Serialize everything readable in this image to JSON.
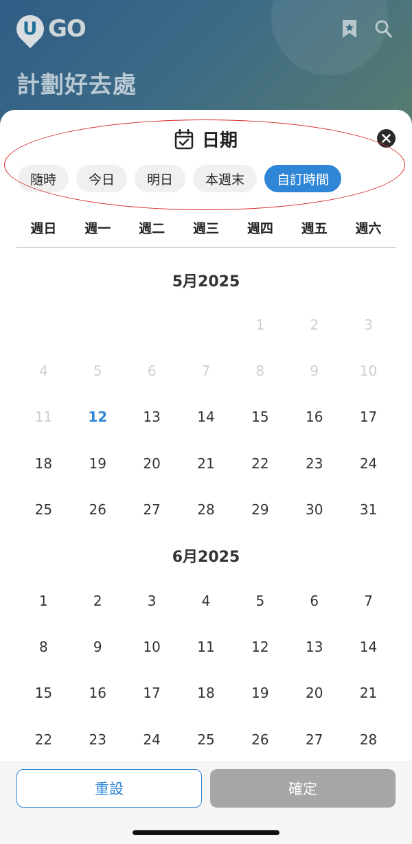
{
  "app": {
    "logo_letter": "U",
    "logo_text": "GO",
    "background_title": "計劃好去處",
    "icons": {
      "bookmark": "bookmark-star-icon",
      "search": "search-icon"
    }
  },
  "sheet": {
    "title": "日期",
    "title_icon": "calendar-check-icon",
    "close_icon": "close-icon",
    "chips": [
      {
        "label": "隨時",
        "active": false
      },
      {
        "label": "今日",
        "active": false
      },
      {
        "label": "明日",
        "active": false
      },
      {
        "label": "本週末",
        "active": false
      },
      {
        "label": "自訂時間",
        "active": true
      }
    ],
    "weekdays": [
      "週日",
      "週一",
      "週二",
      "週三",
      "週四",
      "週五",
      "週六"
    ]
  },
  "months": [
    {
      "title": "5月2025",
      "days": [
        "",
        "",
        "",
        "",
        "1",
        "2",
        "3",
        "4",
        "5",
        "6",
        "7",
        "8",
        "9",
        "10",
        "11",
        "12",
        "13",
        "14",
        "15",
        "16",
        "17",
        "18",
        "19",
        "20",
        "21",
        "22",
        "23",
        "24",
        "25",
        "26",
        "27",
        "28",
        "29",
        "30",
        "31"
      ],
      "disabled_until": "11",
      "today": "12"
    },
    {
      "title": "6月2025",
      "days": [
        "1",
        "2",
        "3",
        "4",
        "5",
        "6",
        "7",
        "8",
        "9",
        "10",
        "11",
        "12",
        "13",
        "14",
        "15",
        "16",
        "17",
        "18",
        "19",
        "20",
        "21",
        "22",
        "23",
        "24",
        "25",
        "26",
        "27",
        "28"
      ]
    }
  ],
  "footer": {
    "reset_label": "重設",
    "confirm_label": "確定"
  },
  "colors": {
    "accent": "#2f86d6",
    "disabled_text": "#cfcfcf",
    "confirm_disabled": "#a6a6a6",
    "annotation": "#d62828"
  }
}
